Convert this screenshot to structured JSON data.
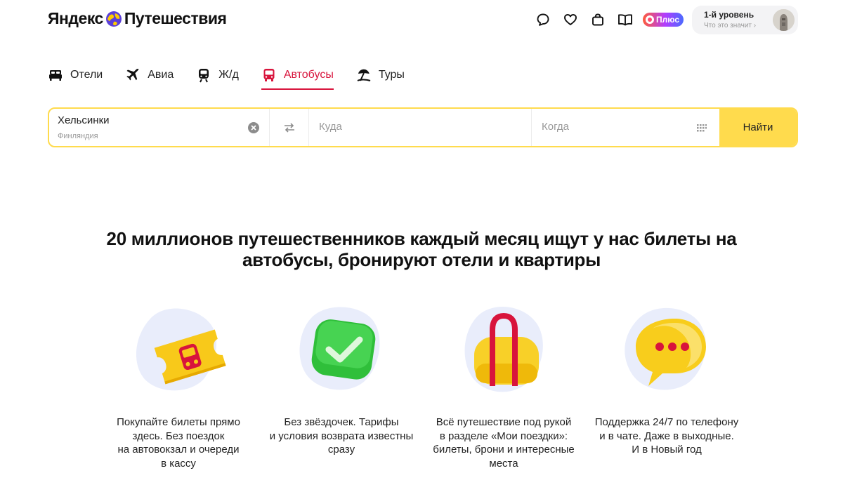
{
  "header": {
    "logo": {
      "part1": "Яндекс",
      "part2": "Путешествия"
    },
    "icons": [
      "chat-icon",
      "heart-icon",
      "bag-icon",
      "book-icon"
    ],
    "plus_label": "Плюс",
    "level": {
      "title": "1-й уровень",
      "subtitle": "Что это значит ›"
    }
  },
  "tabs": [
    {
      "label": "Отели",
      "icon": "hotel-bed-icon",
      "active": false
    },
    {
      "label": "Авиа",
      "icon": "plane-icon",
      "active": false
    },
    {
      "label": "Ж/д",
      "icon": "train-icon",
      "active": false
    },
    {
      "label": "Автобусы",
      "icon": "bus-icon",
      "active": true
    },
    {
      "label": "Туры",
      "icon": "beach-umbrella-icon",
      "active": false
    }
  ],
  "search": {
    "from": {
      "value": "Хельсинки",
      "sub": "Финляндия"
    },
    "to": {
      "placeholder": "Куда"
    },
    "when": {
      "placeholder": "Когда"
    },
    "submit": "Найти"
  },
  "headline": "20 миллионов путешественников каждый месяц ищут у нас билеты на автобусы, бронируют отели и квартиры",
  "features": [
    {
      "icon": "bus-ticket-icon",
      "text": "Покупайте билеты прямо\nздесь. Без поездок\nна автовокзал и очереди\nв кассу"
    },
    {
      "icon": "checkmark-icon",
      "text": "Без звёздочек. Тарифы\nи условия возврата известны\nсразу"
    },
    {
      "icon": "travel-bag-icon",
      "text": "Всё путешествие под рукой\nв разделе «Мои поездки»:\nбилеты, брони и интересные\nместа"
    },
    {
      "icon": "speech-bubble-icon",
      "text": "Поддержка 24/7 по телефону\nи в чате. Даже в выходные.\nИ в Новый год"
    }
  ],
  "colors": {
    "accent": "#d8143c",
    "yellow": "#ffdb4d",
    "blob": "#e9edfb"
  }
}
